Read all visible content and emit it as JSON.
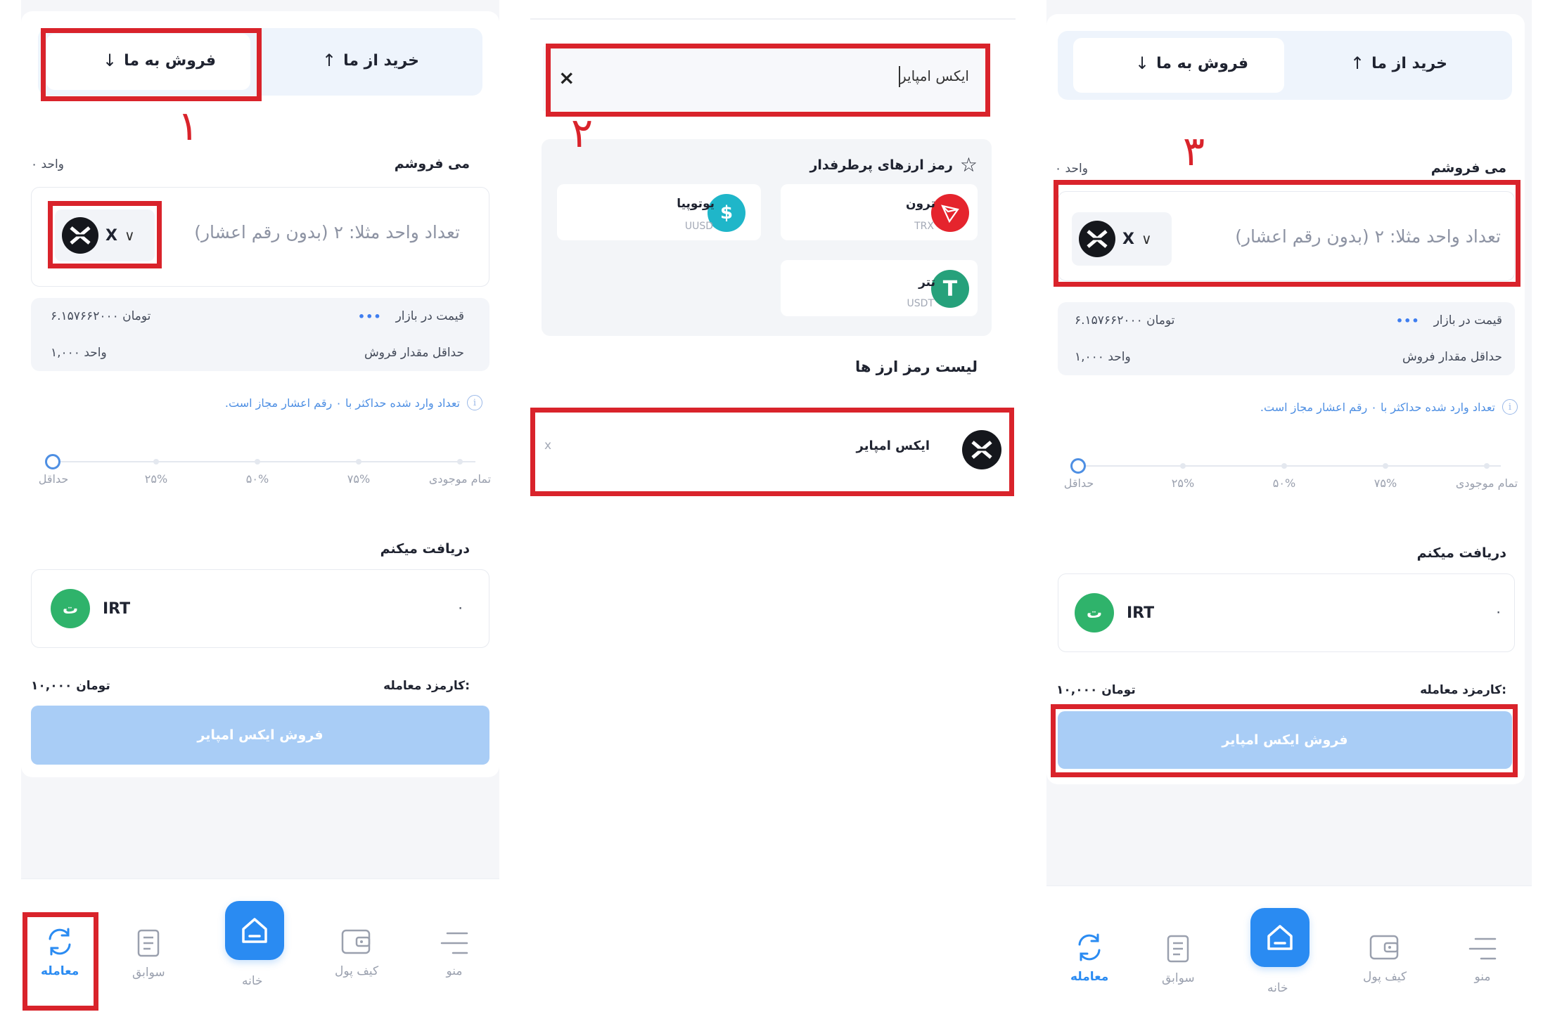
{
  "steps": [
    "١",
    "٢",
    "٣"
  ],
  "trade": {
    "tab_buy": "خرید از ما",
    "tab_sell": "فروش به ما",
    "sell_label": "می فروشم",
    "sell_balance": "۰ واحد",
    "amount_placeholder": "تعداد واحد مثلا: ۲ (بدون رقم اعشار)",
    "coin_symbol": "X",
    "market_price_label": "قیمت در بازار",
    "market_price_value": "۶.۱۵۷۶۶۲۰۰۰ تومان",
    "min_sell_label": "حداقل مقدار فروش",
    "min_sell_value": "۱,۰۰۰ واحد",
    "decimal_note": "تعداد وارد شده حداکثر با ۰ رقم اعشار مجاز است.",
    "slider_labels": [
      "حداقل",
      "۲۵%",
      "۵۰%",
      "۷۵%",
      "تمام موجودی"
    ],
    "receive_label": "دریافت میکنم",
    "receive_currency": "IRT",
    "receive_amount": "۰",
    "fee_label": "کارمزد معامله:",
    "fee_value": "۱۰,۰۰۰ تومان",
    "submit_label": "فروش ایکس امپایر"
  },
  "search": {
    "query": "ایکس امپایر",
    "favorites_title": "رمز ارزهای پرطرفدار",
    "favorites": [
      {
        "name": "ترون",
        "symbol": "TRX",
        "color": "#e5242d"
      },
      {
        "name": "یوتوپیا",
        "symbol": "UUSD",
        "color": "#1fb6c9"
      },
      {
        "name": "تتر",
        "symbol": "USDT",
        "color": "#26a17b"
      }
    ],
    "list_title": "لیست رمز ارز ها",
    "list_item": "ایکس امپایر",
    "list_item_close": "x"
  },
  "nav": {
    "trade": "معامله",
    "history": "سوابق",
    "home": "خانه",
    "wallet": "کیف پول",
    "menu": "منو"
  },
  "colors": {
    "accent": "#2a8bf2",
    "highlight": "#d9232b",
    "button_disabled": "#a9cdf6",
    "irt_green": "#2fb36b"
  }
}
